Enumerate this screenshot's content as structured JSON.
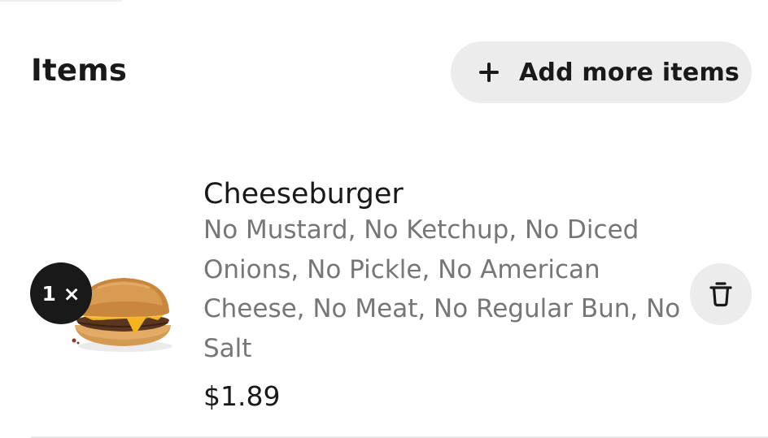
{
  "items_section": {
    "title": "Items",
    "add_button_label": "Add more items",
    "add_icon": "plus-icon"
  },
  "cart_items": [
    {
      "quantity_label": "1 ×",
      "name": "Cheeseburger",
      "options": "No Mustard, No Ketchup, No Diced Onions, No Pickle, No American Cheese, No Meat, No Regular Bun, No Salt",
      "price": "$1.89",
      "image": "cheeseburger",
      "delete_icon": "trash-icon"
    }
  ],
  "colors": {
    "text_primary": "#191919",
    "text_secondary": "#767676",
    "button_bg": "#ececec",
    "badge_bg": "#191919"
  }
}
